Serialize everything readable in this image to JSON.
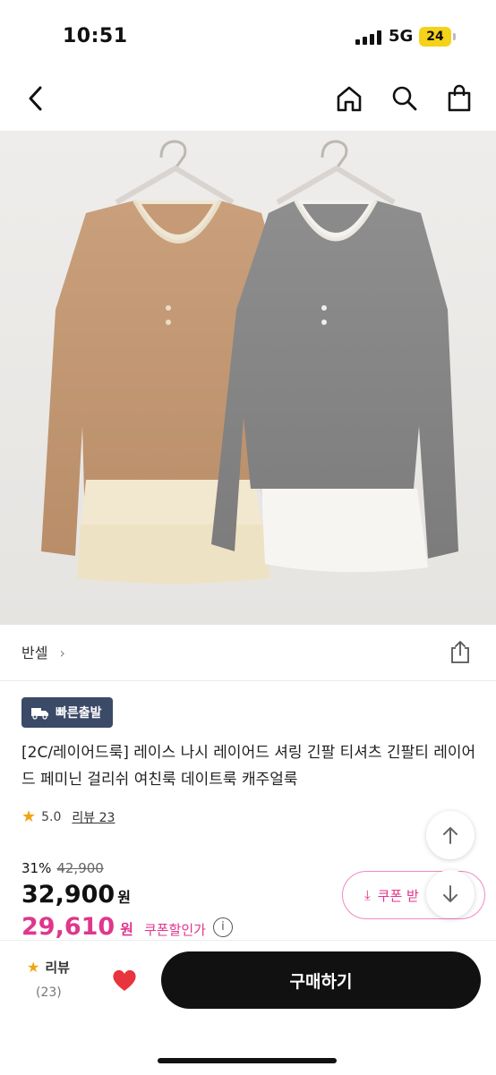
{
  "status": {
    "time": "10:51",
    "network": "5G",
    "battery": "24"
  },
  "seller": {
    "name": "반셀"
  },
  "badge": {
    "label": "빠른출발"
  },
  "product": {
    "title": "[2C/레이어드룩] 레이스 나시 레이어드 셔링 긴팔 티셔츠 긴팔티 레이어드 페미닌 걸리쉬 여친룩 데이트룩 캐주얼룩",
    "rating": "5.0",
    "review_link": "리뷰 23",
    "discount": "31%",
    "original_price": "42,900",
    "price": "32,900",
    "currency": "원",
    "coupon_price": "29,610",
    "coupon_label": "쿠폰할인가",
    "coupon_button": "쿠폰 받"
  },
  "bottom_bar": {
    "review_label": "리뷰",
    "review_count": "(23)",
    "buy_label": "구매하기"
  },
  "colors": {
    "accent_pink": "#e0368c",
    "badge_bg": "#3b4a67",
    "buy_bg": "#111111",
    "star": "#f2a30f",
    "heart": "#e8343c"
  }
}
